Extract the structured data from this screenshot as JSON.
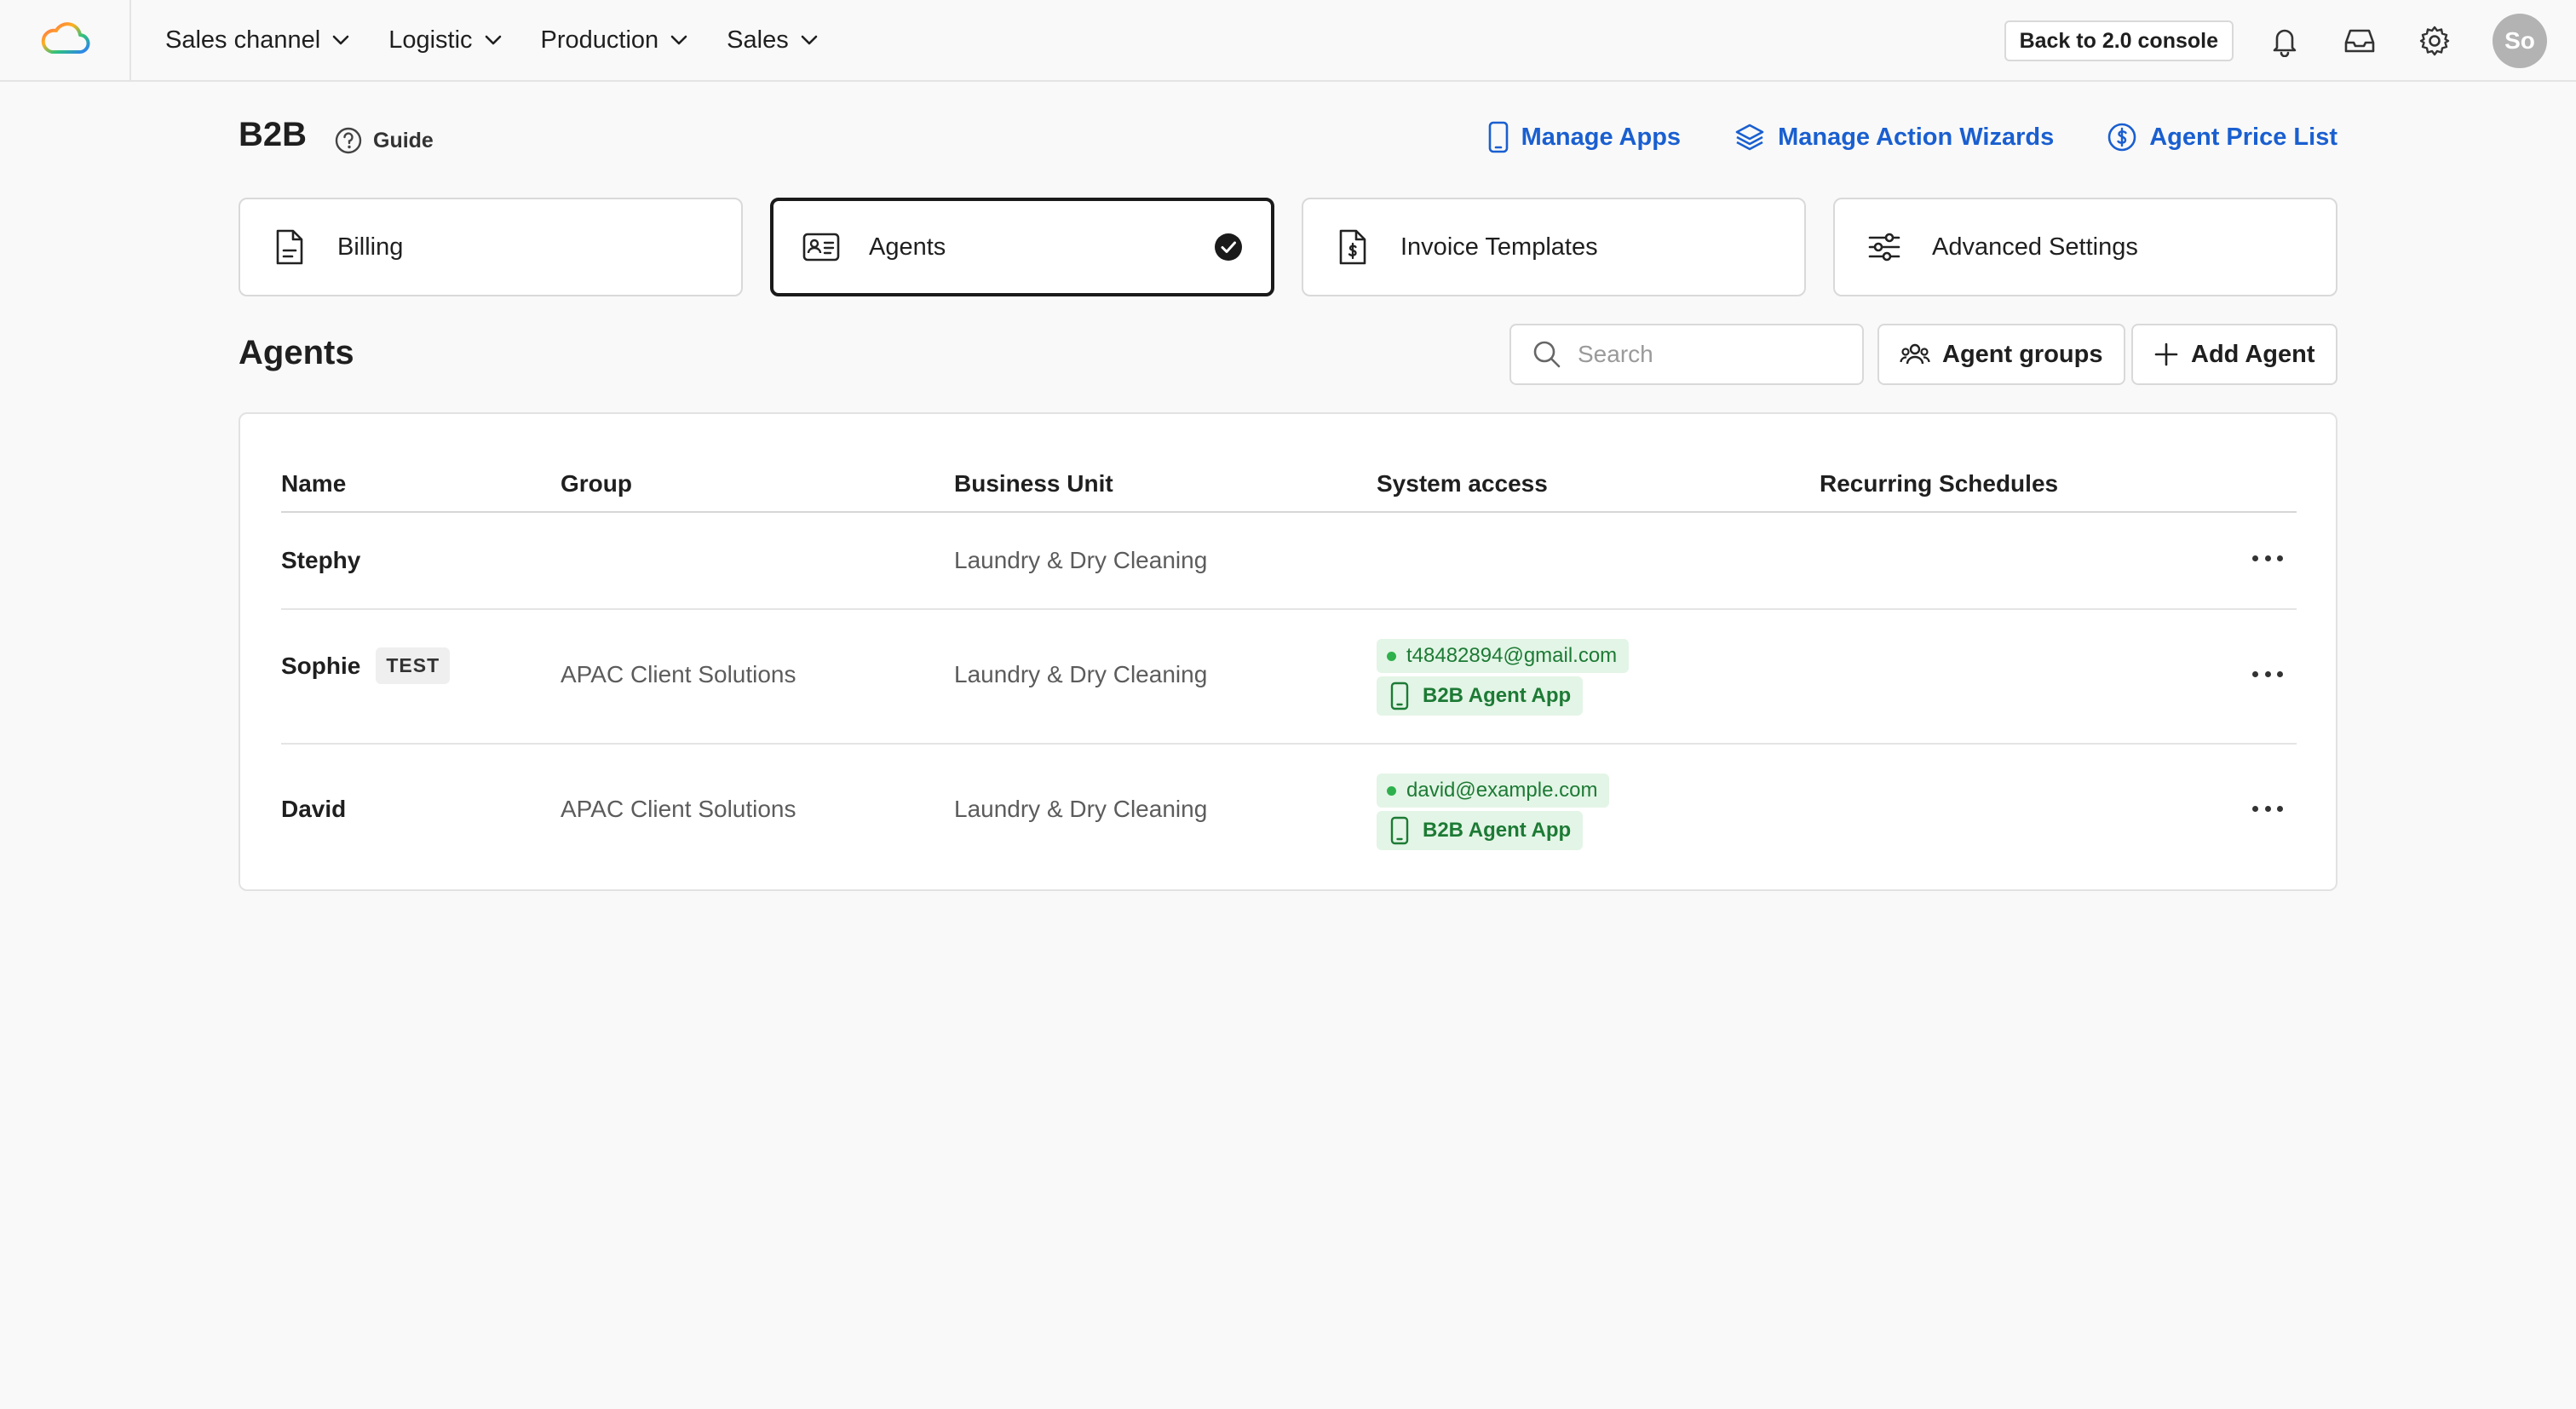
{
  "nav": {
    "logo": "cloud-logo-icon",
    "menu": [
      {
        "label": "Sales channel"
      },
      {
        "label": "Logistic"
      },
      {
        "label": "Production"
      },
      {
        "label": "Sales"
      }
    ],
    "console_button": "Back to 2.0 console",
    "avatar_initials": "So"
  },
  "header": {
    "title": "B2B",
    "guide": "Guide",
    "links": [
      {
        "label": "Manage Apps",
        "icon": "phone-icon"
      },
      {
        "label": "Manage Action Wizards",
        "icon": "layers-icon"
      },
      {
        "label": "Agent Price List",
        "icon": "dollar-circle-icon"
      }
    ]
  },
  "cards": [
    {
      "label": "Billing",
      "icon": "document-icon",
      "active": false
    },
    {
      "label": "Agents",
      "icon": "id-card-icon",
      "active": true
    },
    {
      "label": "Invoice Templates",
      "icon": "invoice-dollar-icon",
      "active": false
    },
    {
      "label": "Advanced Settings",
      "icon": "sliders-icon",
      "active": false
    }
  ],
  "section": {
    "title": "Agents",
    "search_placeholder": "Search",
    "agent_groups_button": "Agent groups",
    "add_agent_button": "Add Agent"
  },
  "table": {
    "columns": [
      "Name",
      "Group",
      "Business Unit",
      "System access",
      "Recurring Schedules"
    ],
    "rows": [
      {
        "name": "Stephy",
        "tag": "",
        "group": "",
        "business_unit": "Laundry & Dry Cleaning",
        "email": "",
        "app": "",
        "schedules": ""
      },
      {
        "name": "Sophie",
        "tag": "TEST",
        "group": "APAC Client Solutions",
        "business_unit": "Laundry & Dry Cleaning",
        "email": "t48482894@gmail.com",
        "app": "B2B Agent App",
        "schedules": ""
      },
      {
        "name": "David",
        "tag": "",
        "group": "APAC Client Solutions",
        "business_unit": "Laundry & Dry Cleaning",
        "email": "david@example.com",
        "app": "B2B Agent App",
        "schedules": ""
      }
    ]
  },
  "colors": {
    "accent_link": "#1a5fd0",
    "success_bg": "#e3f5e6",
    "success_text": "#1d7a35"
  }
}
